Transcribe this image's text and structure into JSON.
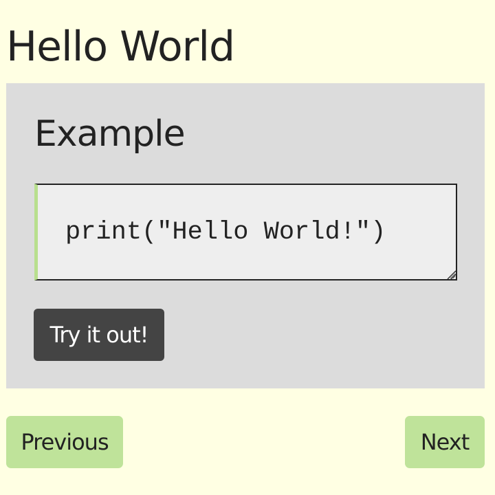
{
  "page": {
    "title": "Hello World"
  },
  "example": {
    "heading": "Example",
    "code": "print(\"Hello World!\")",
    "try_button_label": "Try it out!"
  },
  "navigation": {
    "previous_label": "Previous",
    "next_label": "Next"
  },
  "colors": {
    "page_background": "#ffffe3",
    "panel_background": "#dcdcdc",
    "code_background": "#eeeeee",
    "accent_green": "#b8df8e",
    "nav_button_background": "#bfe39a",
    "try_button_background": "#444444"
  },
  "icons": {
    "resize_handle": "resize-handle-icon"
  }
}
